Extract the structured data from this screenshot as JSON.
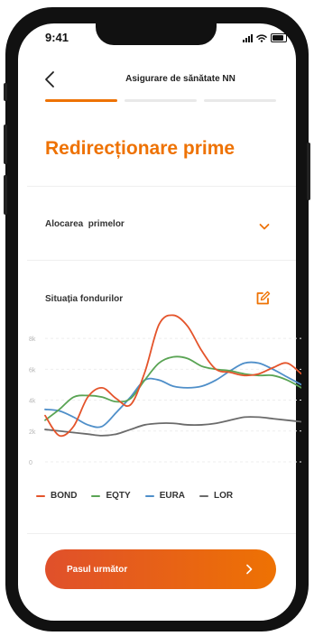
{
  "status_bar": {
    "time": "9:41"
  },
  "header": {
    "title": "Asigurare de sănătate NN"
  },
  "progress": {
    "steps": 3,
    "current": 1
  },
  "page": {
    "title": "Redirecționare prime"
  },
  "allocation": {
    "label": "Alocarea  primelor"
  },
  "funds": {
    "label": "Situația fondurilor"
  },
  "chart_data": {
    "type": "line",
    "y_ticks": [
      "8k",
      "6k",
      "4k",
      "2k",
      "0"
    ],
    "ylim": [
      0,
      9000
    ],
    "x": [
      0,
      1,
      2,
      3,
      4,
      5,
      6,
      7,
      8,
      9,
      10,
      11,
      12,
      13,
      14,
      15,
      16,
      17,
      18
    ],
    "series": [
      {
        "name": "BOND",
        "color": "#e4542b",
        "values": [
          3000,
          1700,
          2300,
          4200,
          4800,
          4100,
          3700,
          5800,
          8900,
          9500,
          8800,
          7200,
          6000,
          5800,
          5600,
          5700,
          6100,
          6400,
          5700
        ]
      },
      {
        "name": "EQTY",
        "color": "#5aa454",
        "values": [
          2700,
          3400,
          4200,
          4300,
          4200,
          3900,
          4100,
          5300,
          6400,
          6800,
          6700,
          6200,
          6000,
          5900,
          5700,
          5600,
          5600,
          5300,
          4800
        ]
      },
      {
        "name": "EURA",
        "color": "#4f8fc9",
        "values": [
          3400,
          3300,
          2900,
          2400,
          2300,
          3200,
          4200,
          5300,
          5300,
          4900,
          4800,
          4900,
          5300,
          5900,
          6400,
          6400,
          6000,
          5500,
          5000
        ]
      },
      {
        "name": "LOR",
        "color": "#6b6b6b",
        "values": [
          2100,
          2000,
          1900,
          1800,
          1700,
          1800,
          2100,
          2400,
          2500,
          2500,
          2400,
          2400,
          2500,
          2700,
          2900,
          2900,
          2800,
          2700,
          2600
        ]
      }
    ]
  },
  "cta": {
    "label": "Pasul următor"
  },
  "icons": {
    "back": "chevron-left-icon",
    "expand": "chevron-down-icon",
    "edit": "edit-icon",
    "next": "chevron-right-icon"
  },
  "colors": {
    "accent": "#ee7203",
    "accent_start": "#e0502b"
  }
}
